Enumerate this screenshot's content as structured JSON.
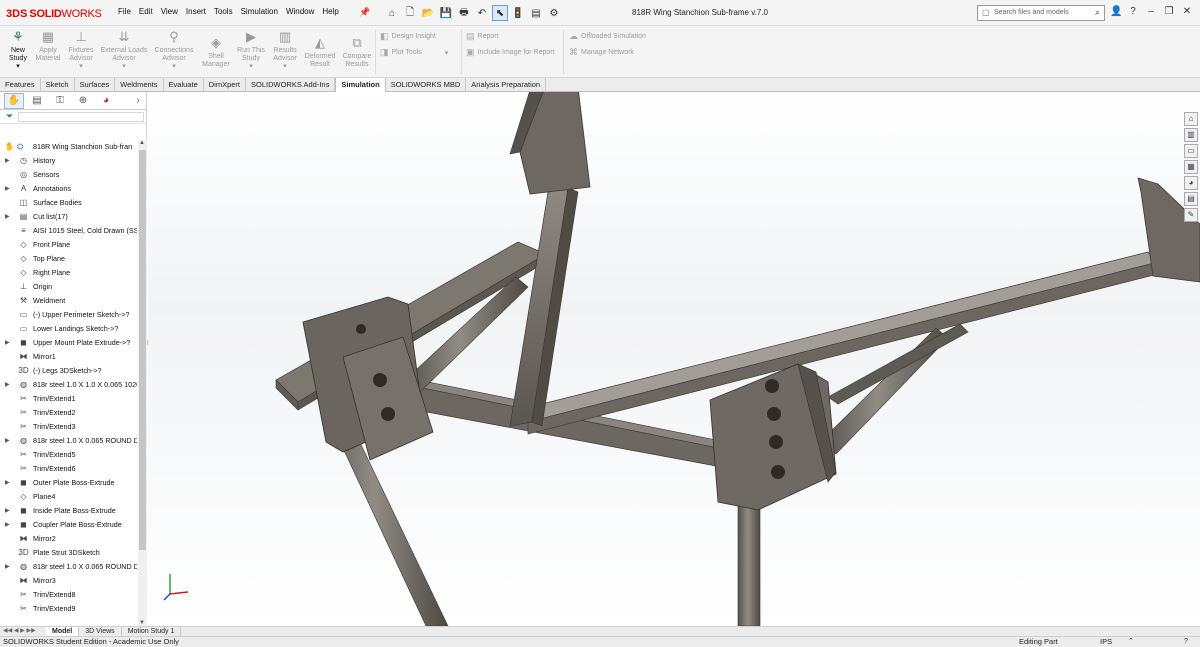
{
  "app": {
    "brand_ds": "3DS",
    "brand_name": "SOLID",
    "brand_name2": "WORKS",
    "doc_title": "818R Wing Stanchion Sub-frame v.7.0"
  },
  "menu": [
    "File",
    "Edit",
    "View",
    "Insert",
    "Tools",
    "Simulation",
    "Window",
    "Help"
  ],
  "search": {
    "placeholder": "Search files and models"
  },
  "ribbon": {
    "large": [
      {
        "label1": "New",
        "label2": "Study",
        "icon": "new-study-icon",
        "active": true
      },
      {
        "label1": "Apply",
        "label2": "Material",
        "icon": "apply-material-icon"
      },
      {
        "label1": "Fixtures",
        "label2": "Advisor",
        "icon": "fixtures-advisor-icon"
      },
      {
        "label1": "External Loads",
        "label2": "Advisor",
        "icon": "external-loads-icon"
      },
      {
        "label1": "Connections",
        "label2": "Advisor",
        "icon": "connections-advisor-icon"
      },
      {
        "label1": "Shell",
        "label2": "Manager",
        "icon": "shell-manager-icon"
      },
      {
        "label1": "Run This",
        "label2": "Study",
        "icon": "run-study-icon"
      },
      {
        "label1": "Results",
        "label2": "Advisor",
        "icon": "results-advisor-icon"
      },
      {
        "label1": "Deformed",
        "label2": "Result",
        "icon": "deformed-result-icon"
      },
      {
        "label1": "Compare",
        "label2": "Results",
        "icon": "compare-results-icon"
      }
    ],
    "small": {
      "design_insight": "Design Insight",
      "plot_tools": "Plot Tools",
      "report": "Report",
      "include_image": "Include Image for Report",
      "offloaded": "Offloaded Simulation",
      "manage_network": "Manage Network"
    }
  },
  "tabs": [
    {
      "label": "Features"
    },
    {
      "label": "Sketch"
    },
    {
      "label": "Surfaces"
    },
    {
      "label": "Weldments"
    },
    {
      "label": "Evaluate"
    },
    {
      "label": "DimXpert"
    },
    {
      "label": "SOLIDWORKS Add-Ins"
    },
    {
      "label": "Simulation",
      "active": true
    },
    {
      "label": "SOLIDWORKS MBD"
    },
    {
      "label": "Analysis Preparation"
    }
  ],
  "tree": [
    {
      "label": "818R Wing Stanchion Sub-fran",
      "root": true
    },
    {
      "label": "History",
      "expand": true,
      "icon": "history-icon"
    },
    {
      "label": "Sensors",
      "icon": "sensors-icon"
    },
    {
      "label": "Annotations",
      "expand": true,
      "icon": "annotations-icon"
    },
    {
      "label": "Surface Bodies",
      "icon": "surface-bodies-icon"
    },
    {
      "label": "Cut list(17)",
      "expand": true,
      "icon": "cut-list-icon"
    },
    {
      "label": "AISI 1015 Steel, Cold Drawn (SS",
      "icon": "material-icon"
    },
    {
      "label": "Front Plane",
      "icon": "plane-icon"
    },
    {
      "label": "Top Plane",
      "icon": "plane-icon"
    },
    {
      "label": "Right Plane",
      "icon": "plane-icon"
    },
    {
      "label": "Origin",
      "icon": "origin-icon"
    },
    {
      "label": "Weldment",
      "icon": "weldment-icon"
    },
    {
      "label": "(-) Upper Perimeter Sketch->?",
      "icon": "sketch-icon"
    },
    {
      "label": "Lower Landings Sketch->?",
      "icon": "sketch-icon"
    },
    {
      "label": "Upper Mount Plate Extrude->?",
      "expand": true,
      "icon": "extrude-icon"
    },
    {
      "label": "Mirror1",
      "icon": "mirror-icon"
    },
    {
      "label": "(-) Legs 3DSketch->?",
      "icon": "3dsketch-icon"
    },
    {
      "label": "818r steel 1.0 X 1.0 X 0.065 1020",
      "expand": true,
      "icon": "structural-member-icon"
    },
    {
      "label": "Trim/Extend1",
      "icon": "trim-extend-icon"
    },
    {
      "label": "Trim/Extend2",
      "icon": "trim-extend-icon"
    },
    {
      "label": "Trim/Extend3",
      "icon": "trim-extend-icon"
    },
    {
      "label": "818r steel 1.0 X 0.065 ROUND D",
      "expand": true,
      "icon": "structural-member-icon"
    },
    {
      "label": "Trim/Extend5",
      "icon": "trim-extend-icon"
    },
    {
      "label": "Trim/Extend6",
      "icon": "trim-extend-icon"
    },
    {
      "label": "Outer Plate Boss-Extrude",
      "expand": true,
      "icon": "extrude-icon"
    },
    {
      "label": "Plane4",
      "icon": "plane-icon"
    },
    {
      "label": "Inside Plate Boss-Extrude",
      "expand": true,
      "icon": "extrude-icon"
    },
    {
      "label": "Coupler Plate Boss-Extrude",
      "expand": true,
      "icon": "extrude-icon"
    },
    {
      "label": "Mirror2",
      "icon": "mirror-icon"
    },
    {
      "label": "Plate Strut 3DSketch",
      "icon": "3dsketch-icon"
    },
    {
      "label": "818r steel 1.0 X 0.065 ROUND D",
      "expand": true,
      "icon": "structural-member-icon"
    },
    {
      "label": "Mirror3",
      "icon": "mirror-icon"
    },
    {
      "label": "Trim/Extend8",
      "icon": "trim-extend-icon"
    },
    {
      "label": "Trim/Extend9",
      "icon": "trim-extend-icon"
    }
  ],
  "bottom_tabs": [
    {
      "label": "Model",
      "active": true
    },
    {
      "label": "3D Views"
    },
    {
      "label": "Motion Study 1"
    }
  ],
  "status": {
    "left": "SOLIDWORKS Student Edition - Academic Use Only",
    "mode": "Editing Part",
    "units": "IPS"
  },
  "colors": {
    "brand": "#d01010",
    "steel": "#6f6a63",
    "steel_dark": "#4a4640",
    "steel_light": "#8f8a82",
    "accent": "#2d6fb5"
  }
}
